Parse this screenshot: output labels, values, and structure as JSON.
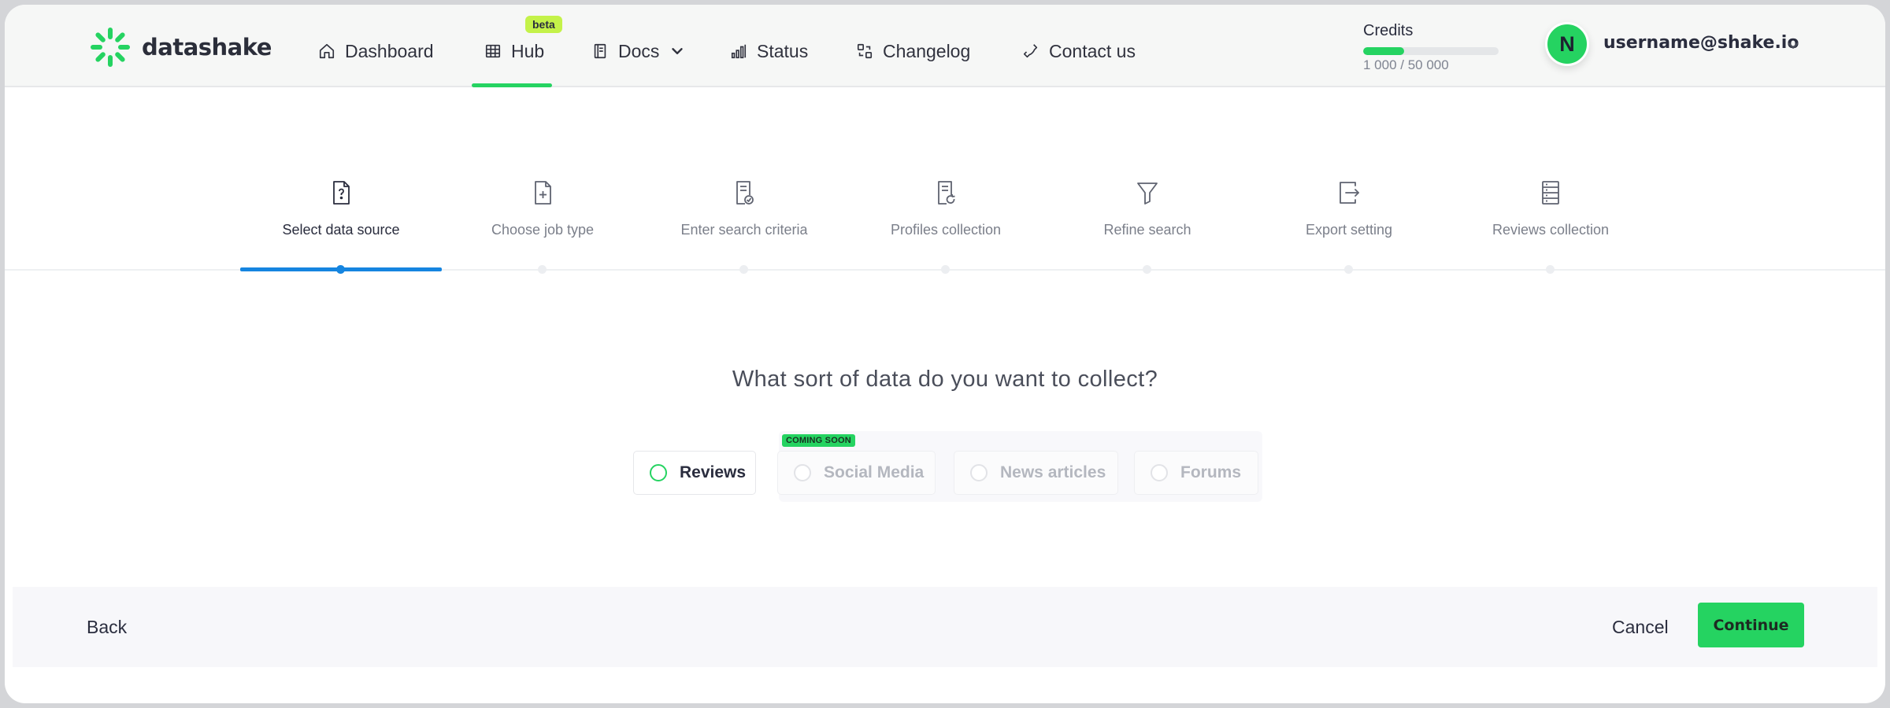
{
  "brand": {
    "name": "datashake",
    "accent_color": "#25d361"
  },
  "nav": {
    "items": [
      {
        "label": "Dashboard",
        "icon": "home-icon"
      },
      {
        "label": "Hub",
        "icon": "grid-icon",
        "badge": "beta",
        "active": true
      },
      {
        "label": "Docs",
        "icon": "document-icon",
        "dropdown": true
      },
      {
        "label": "Status",
        "icon": "bar-chart-icon"
      },
      {
        "label": "Changelog",
        "icon": "changelog-icon"
      },
      {
        "label": "Contact us",
        "icon": "phone-icon"
      }
    ]
  },
  "credits": {
    "label": "Credits",
    "used_text": "1 000 / 50 000",
    "used": 1000,
    "total": 50000,
    "progress_fraction": 0.3
  },
  "user": {
    "avatar_initial": "N",
    "email": "username@shake.io"
  },
  "steps": [
    {
      "label": "Select data source",
      "icon": "file-question-icon",
      "active": true
    },
    {
      "label": "Choose job type",
      "icon": "file-plus-icon"
    },
    {
      "label": "Enter search criteria",
      "icon": "file-check-icon"
    },
    {
      "label": "Profiles collection",
      "icon": "file-refresh-icon"
    },
    {
      "label": "Refine search",
      "icon": "funnel-icon"
    },
    {
      "label": "Export setting",
      "icon": "export-icon"
    },
    {
      "label": "Reviews collection",
      "icon": "list-icon"
    }
  ],
  "question": "What sort of data do you want to collect?",
  "options": [
    {
      "label": "Reviews",
      "enabled": true
    },
    {
      "label": "Social Media",
      "enabled": false
    },
    {
      "label": "News articles",
      "enabled": false
    },
    {
      "label": "Forums",
      "enabled": false
    }
  ],
  "coming_soon_label": "COMING SOON",
  "footer": {
    "back_label": "Back",
    "cancel_label": "Cancel",
    "continue_label": "Continue"
  }
}
